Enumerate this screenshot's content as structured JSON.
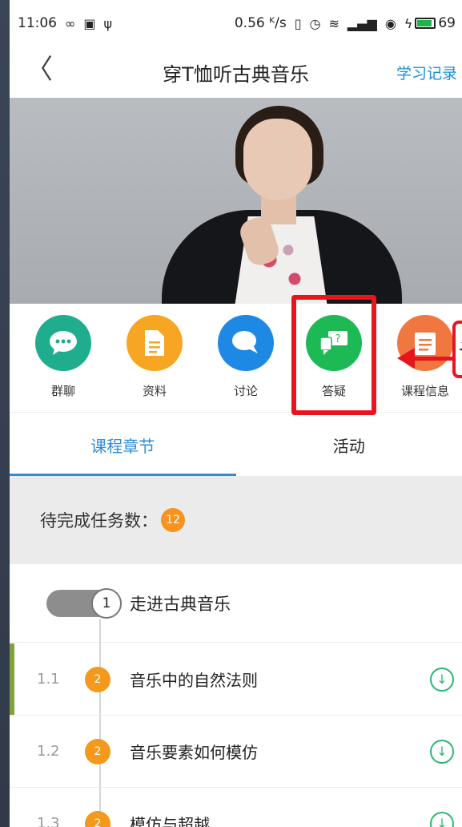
{
  "status_bar": {
    "time": "11:06",
    "speed": "0.56 ᴷ/s",
    "battery": "69"
  },
  "titlebar": {
    "title": "穿T恤听古典音乐",
    "record_label": "学习记录"
  },
  "tools": [
    {
      "label": "群聊",
      "icon": "chat-bubble-icon",
      "color": "#1fad8e"
    },
    {
      "label": "资料",
      "icon": "document-icon",
      "color": "#f6a623"
    },
    {
      "label": "讨论",
      "icon": "discussion-icon",
      "color": "#1e88e5"
    },
    {
      "label": "答疑",
      "icon": "qa-icon",
      "color": "#1db954"
    },
    {
      "label": "课程信息",
      "icon": "course-info-icon",
      "color": "#f07840"
    }
  ],
  "annotation_text": "请",
  "tabs": {
    "chapters": "课程章节",
    "activities": "活动"
  },
  "pending": {
    "label": "待完成任务数：",
    "count": "12"
  },
  "chapter": {
    "number": "1",
    "title": "走进古典音乐"
  },
  "lessons": [
    {
      "num": "1.1",
      "badge": "2",
      "title": "音乐中的自然法则"
    },
    {
      "num": "1.2",
      "badge": "2",
      "title": "音乐要素如何模仿"
    },
    {
      "num": "1.3",
      "badge": "2",
      "title": "模仿与超越"
    }
  ]
}
